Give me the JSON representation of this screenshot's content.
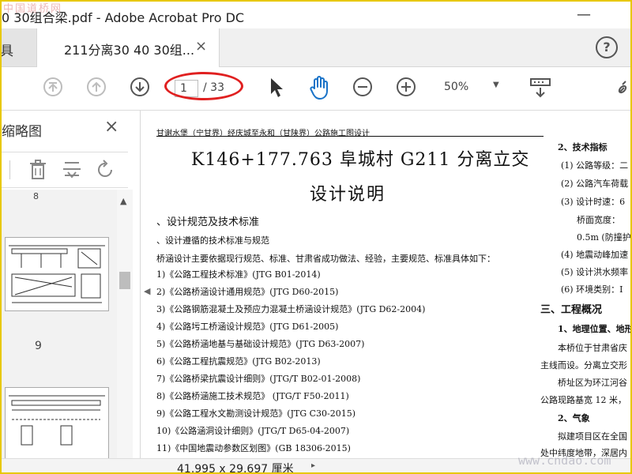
{
  "window": {
    "title": "0 30组合梁.pdf - Adobe Acrobat Pro DC",
    "watermark": "中国道桥网",
    "minimize_glyph": "—"
  },
  "tabs": {
    "previous_fragment": "具",
    "active_label": "211分离30 40 30组...",
    "close_glyph": "×",
    "help_glyph": "?"
  },
  "toolbar": {
    "page_current": "1",
    "page_total": "/ 33",
    "zoom": "50%",
    "icons": [
      "first-page-icon",
      "prev-page-icon",
      "next-page-icon",
      "select-cursor-icon",
      "hand-tool-icon",
      "zoom-out-icon",
      "zoom-in-icon",
      "zoom-dropdown-icon",
      "scroll-mode-icon",
      "link-icon"
    ]
  },
  "sidebar": {
    "title": "缩略图",
    "close_glyph": "×",
    "tool_icons": [
      "delete-page-icon",
      "extract-page-icon",
      "rotate-page-icon"
    ],
    "thumbnails": [
      {
        "label": "8"
      },
      {
        "label": "9"
      }
    ]
  },
  "document": {
    "header": "甘谢水堡（宁甘界）经庆城至永和（甘陕界）公路施工图设计",
    "title": "K146+177.763 阜城村 G211 分离立交",
    "subtitle": "设计说明",
    "left_lines": [
      "、设计规范及技术标准",
      "、设计遵循的技术标准与规范",
      "桥涵设计主要依据现行规范、标准、甘肃省成功做法、经验，主要规范、标准具体如下：",
      "1)《公路工程技术标准》(JTG B01-2014)",
      "2)《公路桥涵设计通用规范》(JTG D60-2015)",
      "3)《公路钢筋混凝土及预应力混凝土桥涵设计规范》(JTG D62-2004)",
      "4)《公路圬工桥涵设计规范》(JTG D61-2005)",
      "5)《公路桥涵地基与基础设计规范》(JTG D63-2007)",
      "6)《公路工程抗震规范》(JTG B02-2013)",
      "7)《公路桥梁抗震设计细则》(JTG/T B02-01-2008)",
      "8)《公路桥涵施工技术规范》 (JTG/T F50-2011)",
      "9)《公路工程水文勘测设计规范》(JTG C30-2015)",
      "10)《公路涵洞设计细则》(JTG/T D65-04-2007)",
      "11)《中国地震动参数区划图》(GB 18306-2015)"
    ],
    "right_lines": [
      "2、技术指标",
      "(1) 公路等级：二",
      "(2) 公路汽车荷载",
      "(3) 设计时速：6",
      "桥面宽度：",
      "0.5m (防撞护",
      "(4) 地震动峰加速",
      "(5) 设计洪水频率",
      "(6) 环境类别：I",
      "三、工程概况",
      "1、地理位置、地形",
      "本桥位于甘肃省庆",
      "主线而设。分离立交形",
      "桥址区为环江河谷",
      "公路现路基宽 12 米，",
      "2、气象",
      "拟建项目区在全国",
      "处中纬度地带，深居内"
    ]
  },
  "statusbar": {
    "page_size": "41.995 x 29.697 厘米",
    "arrow": "▸"
  },
  "watermark_bottom": "www.cndao.com",
  "colors": {
    "frame": "#e8c800",
    "annotation": "#e02020",
    "hand_tool": "#1a73c8"
  }
}
